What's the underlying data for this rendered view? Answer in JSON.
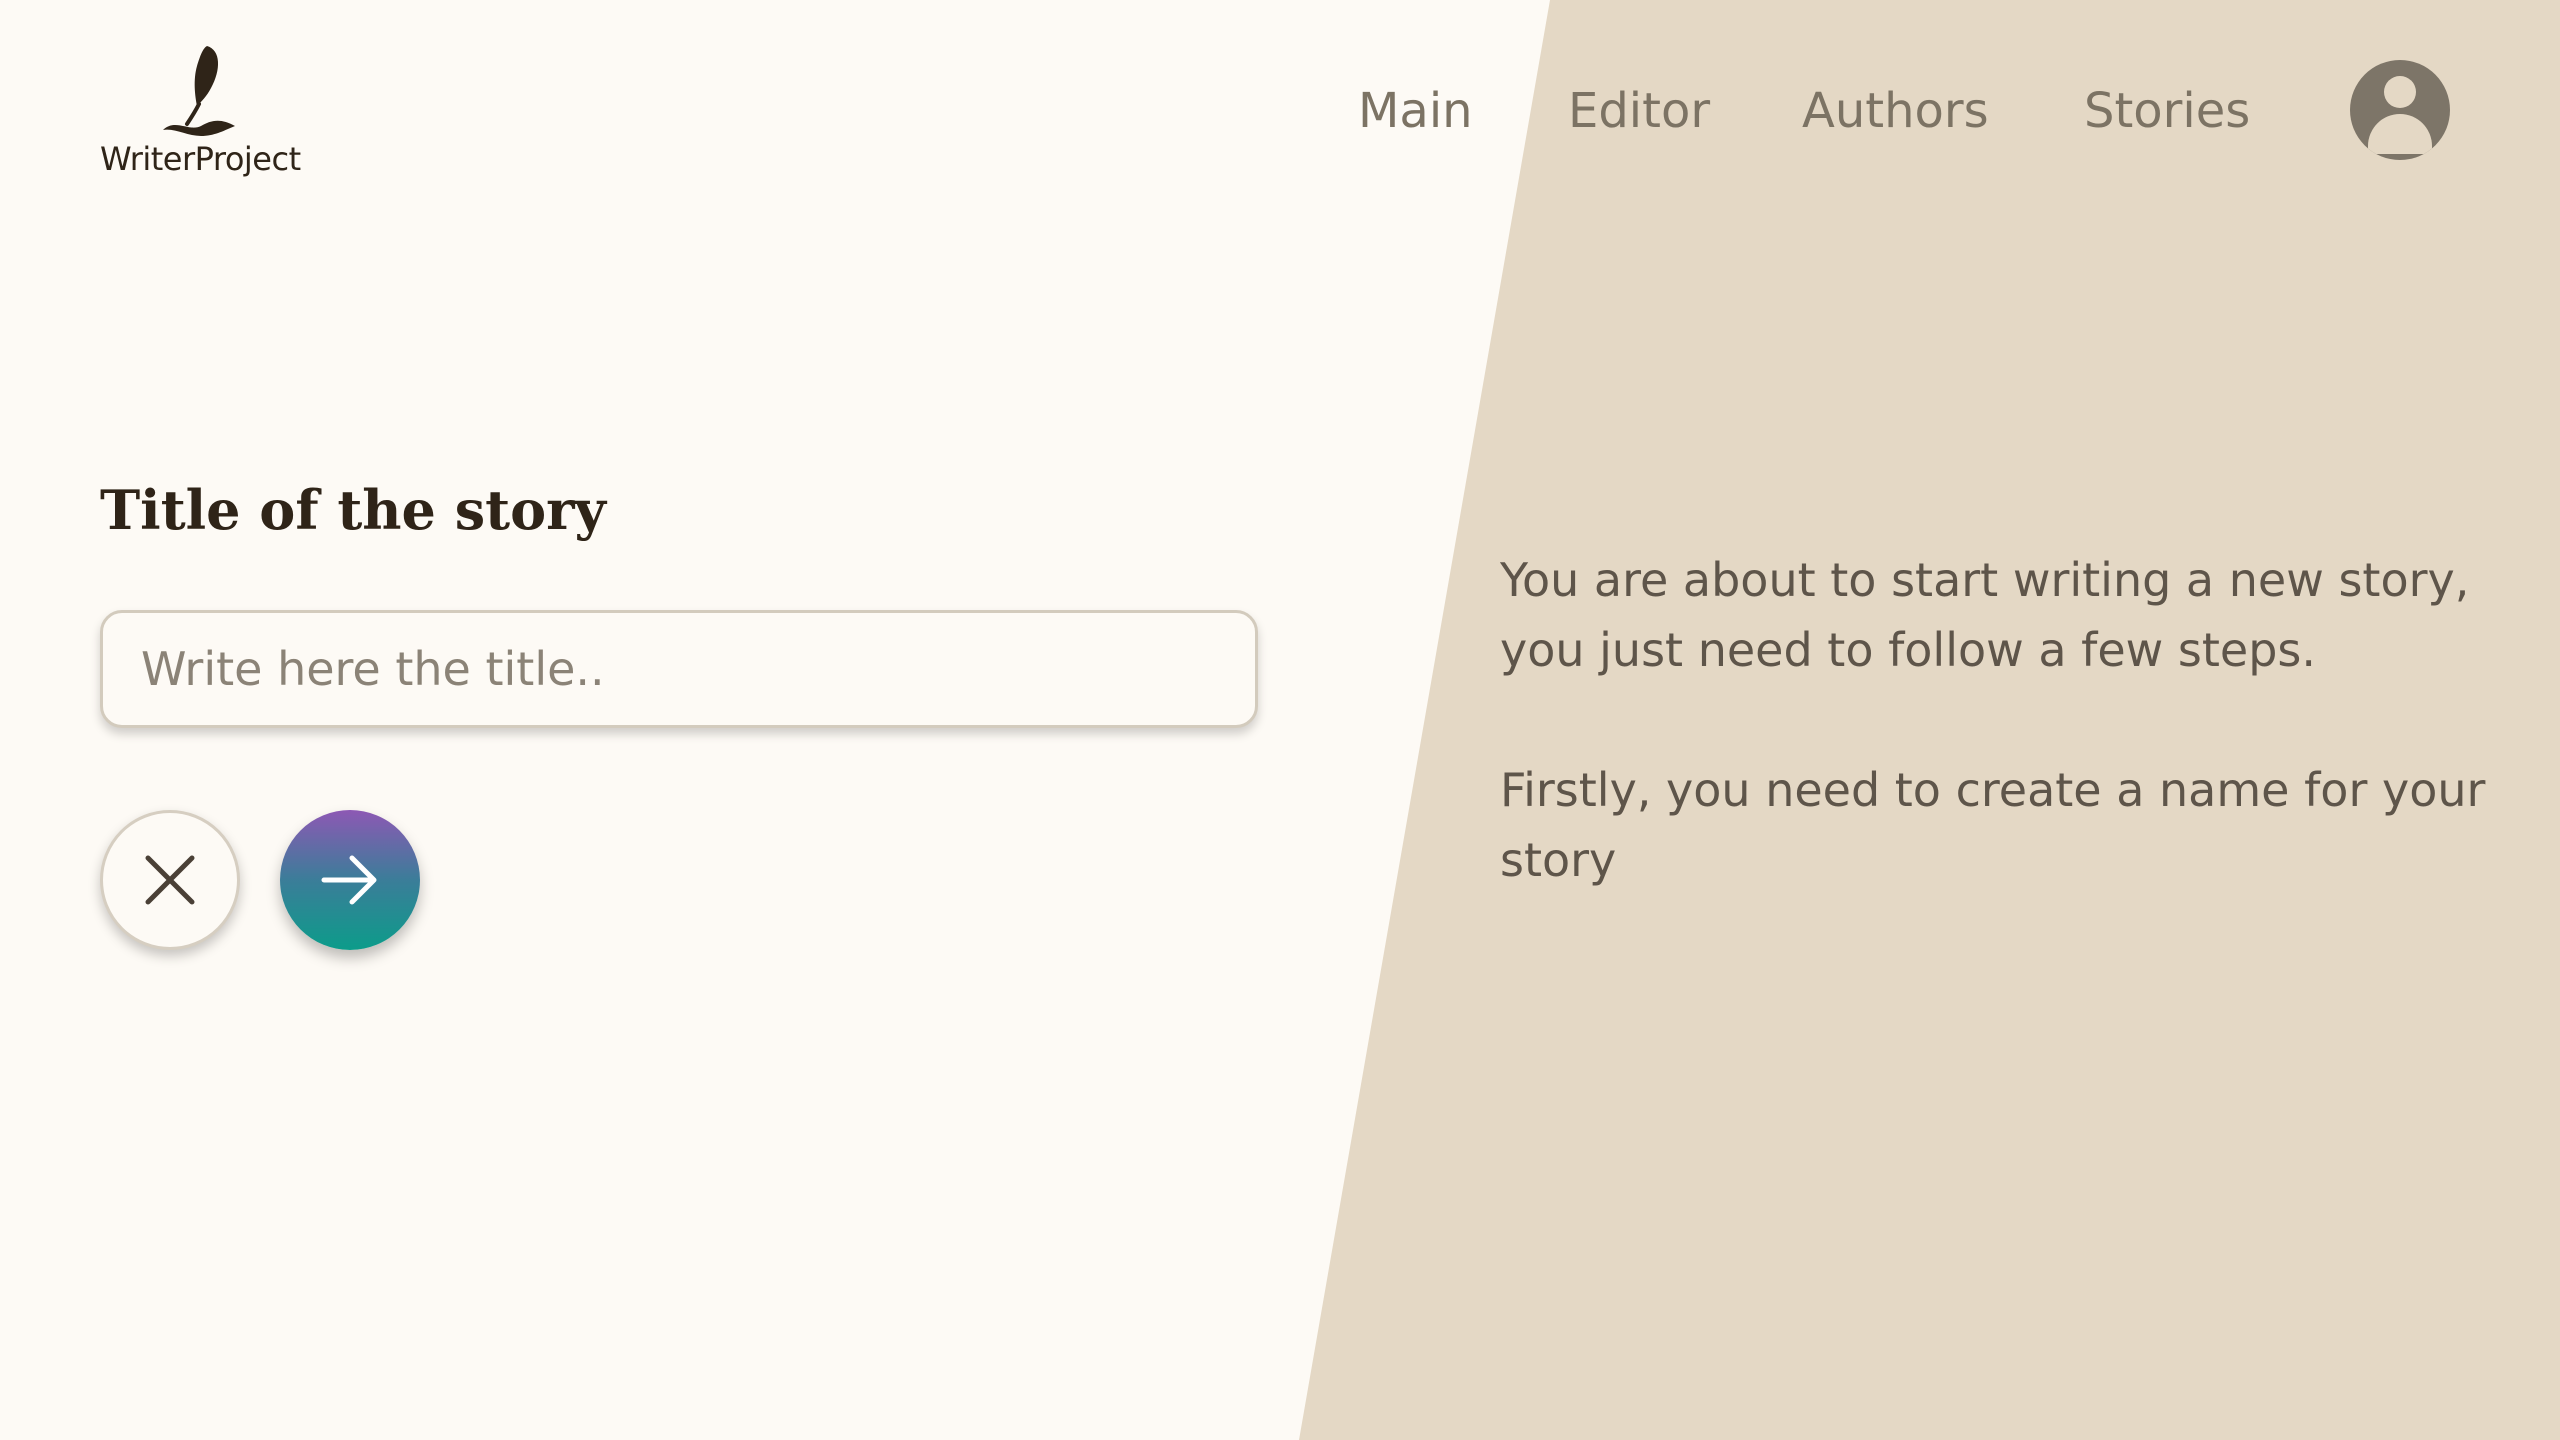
{
  "app": {
    "logo_text": "WriterProject",
    "logo_icon": "quill-icon"
  },
  "nav": {
    "items": [
      {
        "label": "Main"
      },
      {
        "label": "Editor"
      },
      {
        "label": "Authors"
      },
      {
        "label": "Stories"
      }
    ],
    "avatar_icon": "user-avatar-icon"
  },
  "form": {
    "title_label": "Title of the story",
    "title_placeholder": "Write here the title..",
    "title_value": "",
    "cancel_icon": "close-icon",
    "next_icon": "arrow-right-icon"
  },
  "info": {
    "paragraph1": "You are about to start writing a new story, you just need to follow a few steps.",
    "paragraph2": "Firstly, you need to create a name for your story"
  },
  "colors": {
    "background": "#fdfaf5",
    "panel": "#e4d8c5",
    "text_dark": "#2f2418",
    "text_muted": "#7c7364",
    "gradient_top": "#8d58b4",
    "gradient_bottom": "#0c9c8a"
  }
}
